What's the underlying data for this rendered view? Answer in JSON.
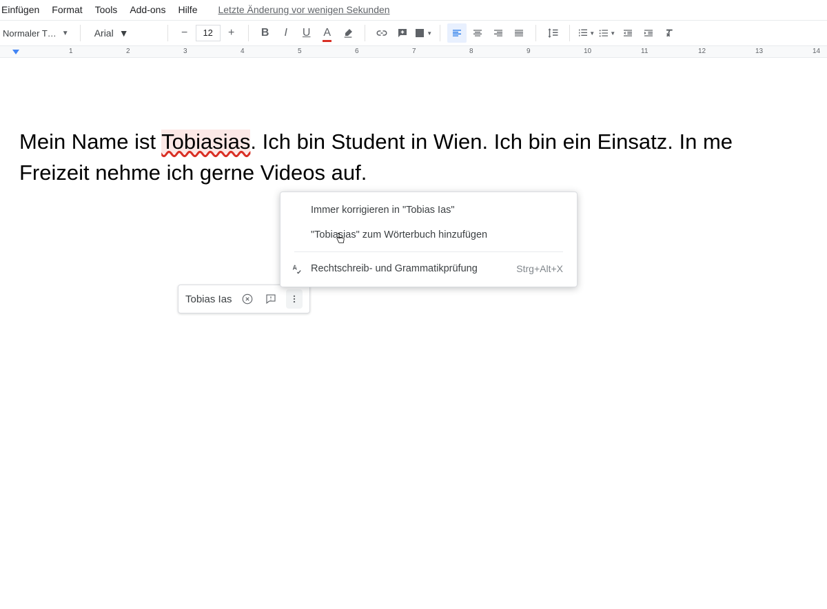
{
  "menubar": {
    "items": [
      "Einfügen",
      "Format",
      "Tools",
      "Add-ons",
      "Hilfe"
    ],
    "last_edit": "Letzte Änderung vor wenigen Sekunden"
  },
  "toolbar": {
    "style_label": "Normaler T…",
    "font_label": "Arial",
    "font_size": "12"
  },
  "ruler": {
    "ticks": [
      "1",
      "2",
      "3",
      "4",
      "5",
      "6",
      "7",
      "8",
      "9",
      "10",
      "11",
      "12",
      "13",
      "14"
    ]
  },
  "document": {
    "before_error": "Mein Name ist ",
    "error_word": "Tobiasias",
    "after_error": ". Ich bin Student in Wien. Ich bin ein Einsatz. In me",
    "line2": "Freizeit nehme ich gerne Videos auf."
  },
  "suggestion_bubble": {
    "suggestion": "Tobias Ias"
  },
  "context_menu": {
    "always_correct": "Immer korrigieren in \"Tobias Ias\"",
    "add_to_dict": "\"Tobiasias\" zum Wörterbuch hinzufügen",
    "spell_grammar": "Rechtschreib- und Grammatikprüfung",
    "shortcut": "Strg+Alt+X"
  }
}
